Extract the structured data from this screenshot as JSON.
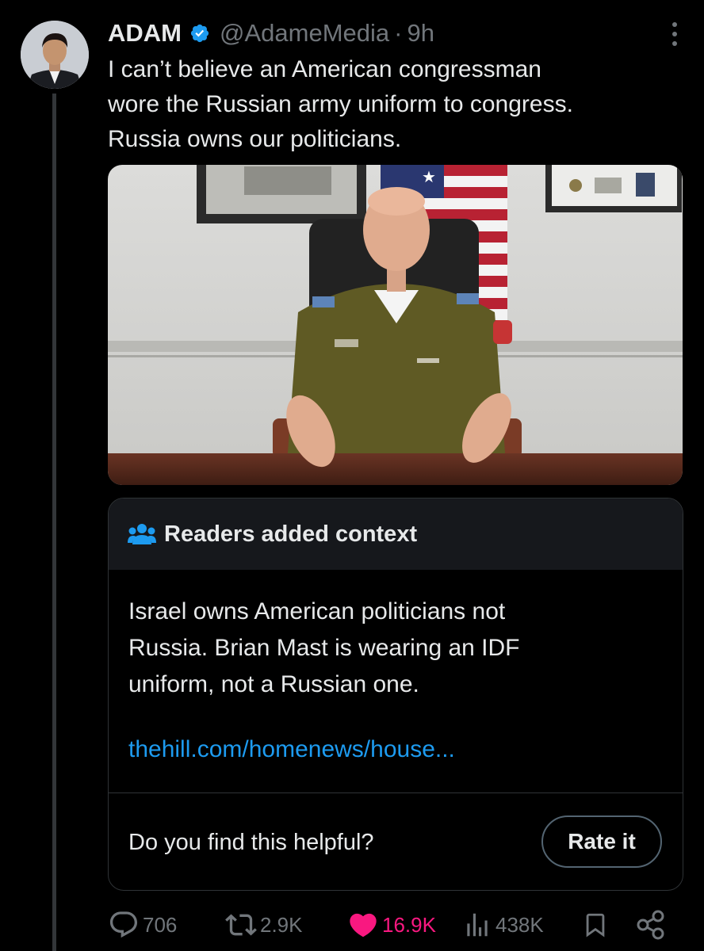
{
  "tweet": {
    "author_name": "ADAM",
    "handle": "@AdameMedia",
    "separator": "·",
    "time": "9h",
    "text_lines": [
      "I can’t believe an American congressman",
      "wore the Russian army uniform to congress.",
      "Russia owns our politicians."
    ]
  },
  "community_note": {
    "header": "Readers added context",
    "body_lines": [
      "Israel owns American politicians not",
      "Russia. Brian Mast is wearing an IDF",
      "uniform, not a Russian one."
    ],
    "link_text": "thehill.com/homenews/house...",
    "helpful_prompt": "Do you find this helpful?",
    "rate_button": "Rate it"
  },
  "actions": {
    "replies": "706",
    "reposts": "2.9K",
    "likes": "16.9K",
    "views": "438K"
  },
  "icons": [
    "verified-badge-icon",
    "more-options-icon",
    "people-icon",
    "reply-icon",
    "repost-icon",
    "like-icon",
    "views-icon",
    "bookmark-icon",
    "share-icon"
  ],
  "colors": {
    "background": "#000000",
    "text": "#e7e9ea",
    "secondary_text": "#71767b",
    "link": "#1d9bf0",
    "verified": "#1d9bf0",
    "like": "#f91880",
    "note_header_bg": "#16181c",
    "border": "#2f3336"
  }
}
